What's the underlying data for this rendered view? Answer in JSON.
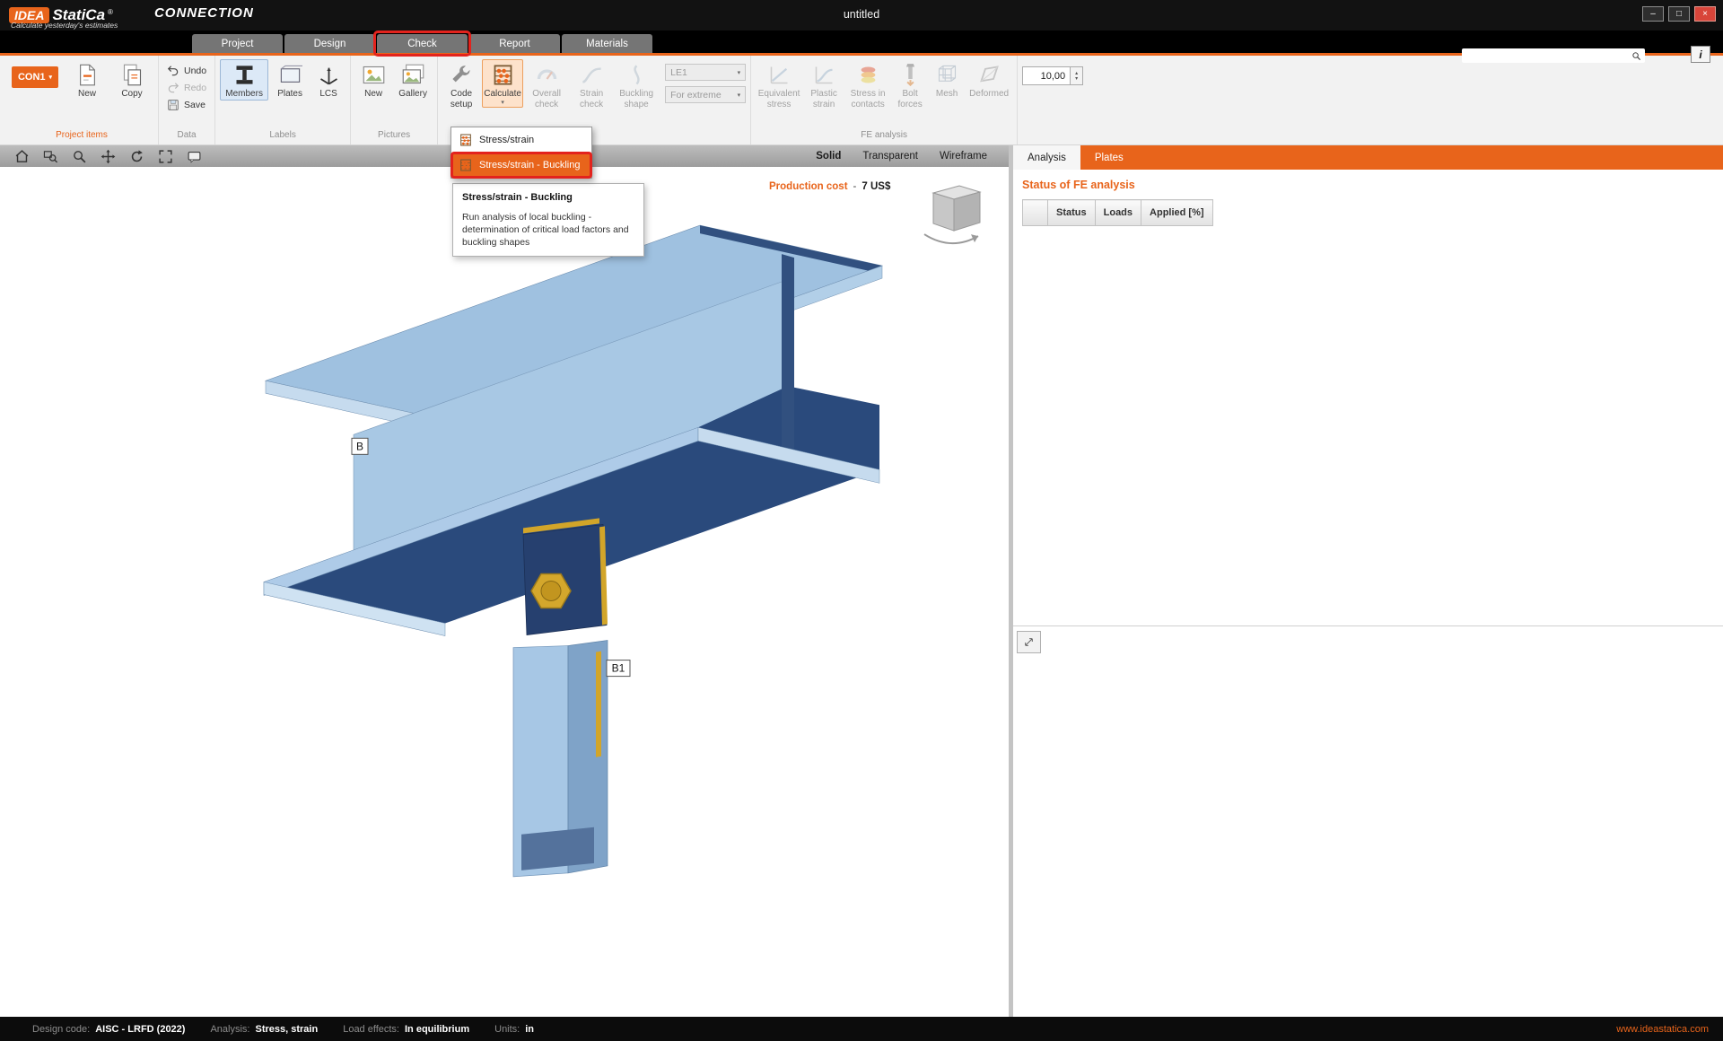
{
  "accent_color": "#e8641b",
  "annotation_color": "#e3231d",
  "titlebar": {
    "logo_idea": "IDEA",
    "logo_statica": "StatiCa",
    "logo_reg": "®",
    "tagline": "Calculate yesterday's estimates",
    "app_name": "CONNECTION",
    "document_title": "untitled",
    "minimize_glyph": "–",
    "maximize_glyph": "□",
    "close_glyph": "×"
  },
  "tab_bar": {
    "tabs": [
      {
        "label": "Project"
      },
      {
        "label": "Design"
      },
      {
        "label": "Check"
      },
      {
        "label": "Report"
      },
      {
        "label": "Materials"
      }
    ],
    "info_button_label": "i"
  },
  "ribbon": {
    "groups": {
      "project_items": {
        "label": "Project items",
        "con_selector": "CON1",
        "new": "New",
        "copy": "Copy"
      },
      "data": {
        "label": "Data",
        "undo": "Undo",
        "redo": "Redo",
        "save": "Save"
      },
      "labels": {
        "label": "Labels",
        "members": "Members",
        "plates": "Plates",
        "lcs": "LCS"
      },
      "pictures": {
        "label": "Pictures",
        "new": "New",
        "gallery": "Gallery"
      },
      "check": {
        "code_setup": "Code setup",
        "calculate": "Calculate",
        "overall_check": "Overall check",
        "strain_check": "Strain check",
        "buckling_shape": "Buckling shape",
        "load_case": "LE1",
        "extreme": "For extreme"
      },
      "fe_analysis": {
        "label": "FE analysis",
        "equivalent_stress": "Equivalent stress",
        "plastic_strain": "Plastic strain",
        "stress_in_contacts": "Stress in contacts",
        "bolt_forces": "Bolt forces",
        "mesh": "Mesh",
        "deformed": "Deformed",
        "scale_value": "10,00"
      }
    }
  },
  "calculate_menu": {
    "items": [
      {
        "label": "Stress/strain"
      },
      {
        "label": "Stress/strain - Buckling",
        "highlighted": true
      }
    ]
  },
  "tooltip": {
    "title": "Stress/strain - Buckling",
    "body": "Run analysis of local buckling - determination of critical load factors and buckling shapes"
  },
  "viewport": {
    "modes": [
      {
        "label": "Solid",
        "active": true
      },
      {
        "label": "Transparent",
        "active": false
      },
      {
        "label": "Wireframe",
        "active": false
      }
    ],
    "production_cost_label": "Production cost",
    "production_cost_separator": "-",
    "production_cost_value": "7 US$",
    "member_label_beam": "B",
    "member_label_column": "B1"
  },
  "right_panel": {
    "tabs": [
      {
        "label": "Analysis",
        "active": true
      },
      {
        "label": "Plates",
        "active": false
      }
    ],
    "heading": "Status of FE analysis",
    "table": {
      "headers": [
        "Status",
        "Loads",
        "Applied [%]"
      ]
    }
  },
  "status_bar": {
    "design_code_label": "Design code:",
    "design_code_value": "AISC - LRFD (2022)",
    "analysis_label": "Analysis:",
    "analysis_value": "Stress, strain",
    "load_effects_label": "Load effects:",
    "load_effects_value": "In equilibrium",
    "units_label": "Units:",
    "units_value": "in",
    "website": "www.ideastatica.com"
  }
}
